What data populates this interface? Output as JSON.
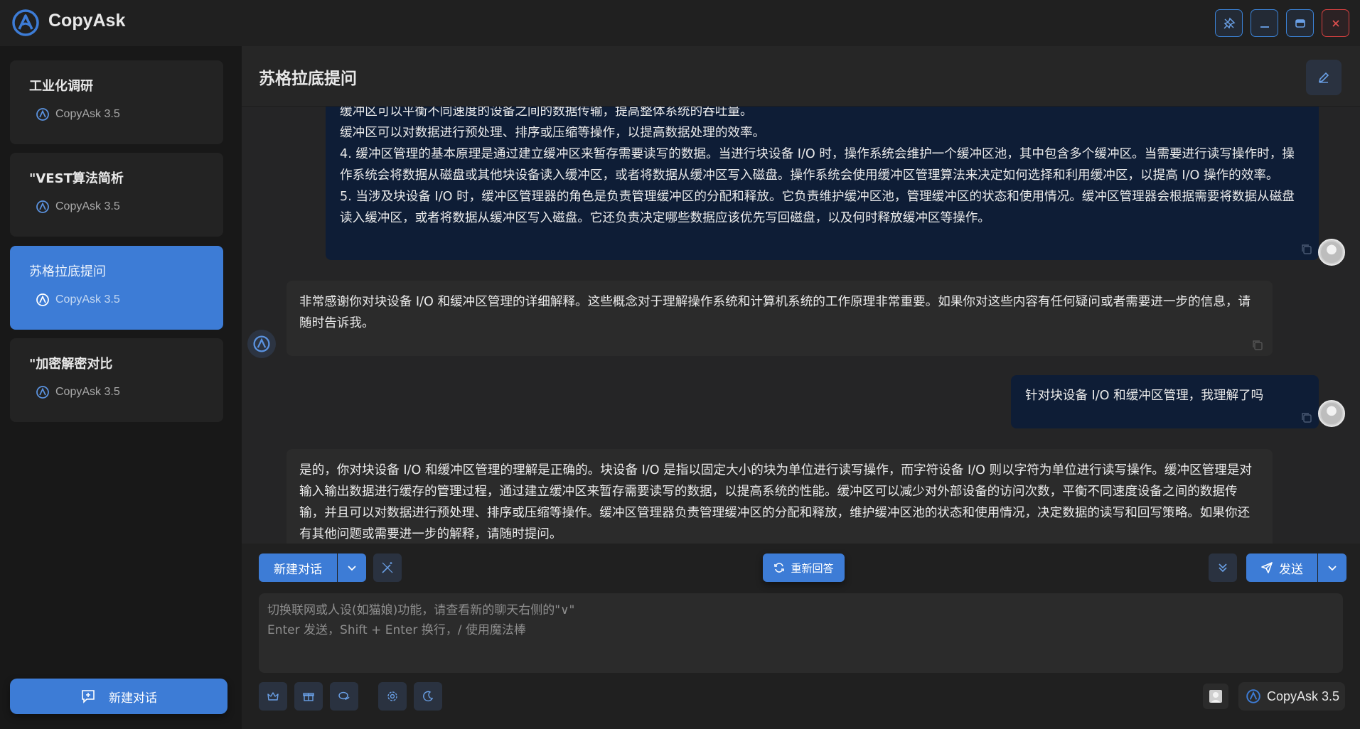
{
  "app": {
    "title": "CopyAsk"
  },
  "window_controls": [
    "pin-icon",
    "minimize-icon",
    "maximize-icon",
    "close-icon"
  ],
  "sidebar": {
    "conversations": [
      {
        "title": "工业化调研",
        "model": "CopyAsk 3.5",
        "active": false
      },
      {
        "title": "\"VEST算法简析",
        "model": "CopyAsk 3.5",
        "active": false
      },
      {
        "title": "苏格拉底提问",
        "model": "CopyAsk 3.5",
        "active": true
      },
      {
        "title": "\"加密解密对比",
        "model": "CopyAsk 3.5",
        "active": false
      }
    ],
    "new_chat_label": "新建对话"
  },
  "main": {
    "title": "苏格拉底提问"
  },
  "messages": [
    {
      "role": "user",
      "lines": [
        "缓冲区可以平衡不同速度的设备之间的数据传输，提高整体系统的吞吐量。",
        "缓冲区可以对数据进行预处理、排序或压缩等操作，以提高数据处理的效率。",
        "4. 缓冲区管理的基本原理是通过建立缓冲区来暂存需要读写的数据。当进行块设备 I/O 时，操作系统会维护一个缓冲区池，其中包含多个缓冲区。当需要进行读写操作时，操作系统会将数据从磁盘或其他块设备读入缓冲区，或者将数据从缓冲区写入磁盘。操作系统会使用缓冲区管理算法来决定如何选择和利用缓冲区，以提高 I/O 操作的效率。",
        "5. 当涉及块设备 I/O 时，缓冲区管理器的角色是负责管理缓冲区的分配和释放。它负责维护缓冲区池，管理缓冲区的状态和使用情况。缓冲区管理器会根据需要将数据从磁盘读入缓冲区，或者将数据从缓冲区写入磁盘。它还负责决定哪些数据应该优先写回磁盘，以及何时释放缓冲区等操作。"
      ]
    },
    {
      "role": "assistant",
      "text": "非常感谢你对块设备 I/O 和缓冲区管理的详细解释。这些概念对于理解操作系统和计算机系统的工作原理非常重要。如果你对这些内容有任何疑问或者需要进一步的信息，请随时告诉我。"
    },
    {
      "role": "user",
      "text": "针对块设备 I/O 和缓冲区管理，我理解了吗"
    },
    {
      "role": "assistant",
      "text": "是的，你对块设备 I/O 和缓冲区管理的理解是正确的。块设备 I/O 是指以固定大小的块为单位进行读写操作，而字符设备 I/O 则以字符为单位进行读写操作。缓冲区管理是对输入输出数据进行缓存的管理过程，通过建立缓冲区来暂存需要读写的数据，以提高系统的性能。缓冲区可以减少对外部设备的访问次数，平衡不同速度设备之间的数据传输，并且可以对数据进行预处理、排序或压缩等操作。缓冲区管理器负责管理缓冲区的分配和释放，维护缓冲区池的状态和使用情况，决定数据的读写和回写策略。如果你还有其他问题或需要进一步的解释，请随时提问。"
    }
  ],
  "composer": {
    "new_chat_label": "新建对话",
    "regenerate_label": "重新回答",
    "send_label": "发送",
    "placeholder_line1": "切换联网或人设(如猫娘)功能，请查看新的聊天右侧的\"∨\"",
    "placeholder_line2": "Enter 发送，Shift + Enter 换行，/ 使用魔法棒",
    "model_label": "CopyAsk 3.5",
    "tools": [
      "crown-icon",
      "gift-icon",
      "chat-icon",
      "settings-icon",
      "moon-icon"
    ]
  },
  "colors": {
    "accent": "#3d7cd6",
    "user_bubble": "#0e1d36",
    "bot_bubble": "#2b2b2b",
    "close": "#d84040"
  }
}
